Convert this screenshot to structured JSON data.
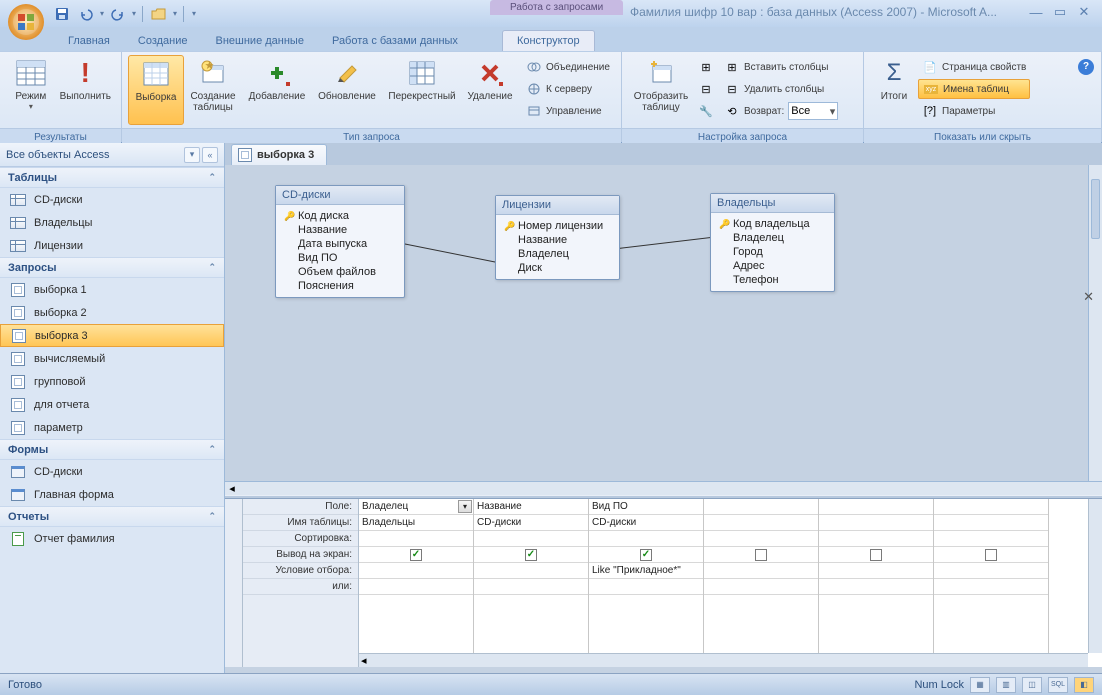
{
  "app": {
    "title": "Фамилия шифр 10 вар : база данных (Access 2007) - Microsoft A...",
    "context_tool": "Работа с запросами"
  },
  "tabs": {
    "home": "Главная",
    "create": "Создание",
    "external": "Внешние данные",
    "dbtools": "Работа с базами данных",
    "design": "Конструктор"
  },
  "ribbon": {
    "results": {
      "label": "Результаты",
      "view": "Режим",
      "run": "Выполнить"
    },
    "qtype": {
      "label": "Тип запроса",
      "select": "Выборка",
      "maketable": "Создание таблицы",
      "append": "Добавление",
      "update": "Обновление",
      "crosstab": "Перекрестный",
      "delete": "Удаление",
      "union": "Объединение",
      "passthrough": "К серверу",
      "datadef": "Управление"
    },
    "setup": {
      "label": "Настройка запроса",
      "showtable": "Отобразить таблицу",
      "insertcols": "Вставить столбцы",
      "deletecols": "Удалить столбцы",
      "return": "Возврат:",
      "return_val": "Все"
    },
    "showhide": {
      "label": "Показать или скрыть",
      "totals": "Итоги",
      "propsheet": "Страница свойств",
      "tablenames": "Имена таблиц",
      "params": "Параметры"
    }
  },
  "nav": {
    "title": "Все объекты Access",
    "groups": {
      "tables": "Таблицы",
      "queries": "Запросы",
      "forms": "Формы",
      "reports": "Отчеты"
    },
    "tables": [
      "CD-диски",
      "Владельцы",
      "Лицензии"
    ],
    "queries": [
      "выборка 1",
      "выборка 2",
      "выборка 3",
      "вычисляемый",
      "групповой",
      "для отчета",
      "параметр"
    ],
    "forms": [
      "CD-диски",
      "Главная форма"
    ],
    "reports": [
      "Отчет фамилия"
    ]
  },
  "doc": {
    "tab": "выборка 3"
  },
  "tablebox": {
    "t1": {
      "title": "CD-диски",
      "fields": [
        "Код диска",
        "Название",
        "Дата выпуска",
        "Вид ПО",
        "Объем файлов",
        "Пояснения"
      ]
    },
    "t2": {
      "title": "Лицензии",
      "fields": [
        "Номер лицензии",
        "Название",
        "Владелец",
        "Диск"
      ]
    },
    "t3": {
      "title": "Владельцы",
      "fields": [
        "Код владельца",
        "Владелец",
        "Город",
        "Адрес",
        "Телефон"
      ]
    }
  },
  "grid": {
    "labels": {
      "field": "Поле:",
      "table": "Имя таблицы:",
      "sort": "Сортировка:",
      "show": "Вывод на экран:",
      "criteria": "Условие отбора:",
      "or": "или:"
    },
    "cols": [
      {
        "field": "Владелец",
        "table": "Владельцы",
        "show": true,
        "criteria": ""
      },
      {
        "field": "Название",
        "table": "CD-диски",
        "show": true,
        "criteria": ""
      },
      {
        "field": "Вид ПО",
        "table": "CD-диски",
        "show": true,
        "criteria": "Like \"Прикладное*\""
      },
      {
        "field": "",
        "table": "",
        "show": false,
        "criteria": ""
      },
      {
        "field": "",
        "table": "",
        "show": false,
        "criteria": ""
      },
      {
        "field": "",
        "table": "",
        "show": false,
        "criteria": ""
      }
    ]
  },
  "status": {
    "ready": "Готово",
    "numlock": "Num Lock"
  }
}
